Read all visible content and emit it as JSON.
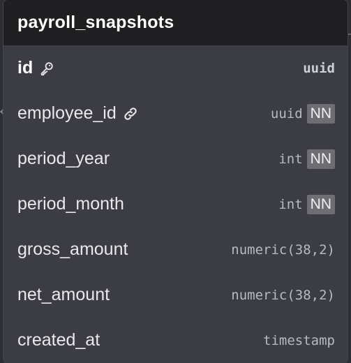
{
  "table": {
    "title": "payroll_snapshots",
    "fields": [
      {
        "name": "id",
        "type": "uuid",
        "primary_key": true,
        "icon": "key-icon",
        "nn": ""
      },
      {
        "name": "employee_id",
        "type": "uuid",
        "primary_key": false,
        "icon": "link-icon",
        "nn": "NN"
      },
      {
        "name": "period_year",
        "type": "int",
        "primary_key": false,
        "icon": "",
        "nn": "NN"
      },
      {
        "name": "period_month",
        "type": "int",
        "primary_key": false,
        "icon": "",
        "nn": "NN"
      },
      {
        "name": "gross_amount",
        "type": "numeric(38,2)",
        "primary_key": false,
        "icon": "",
        "nn": ""
      },
      {
        "name": "net_amount",
        "type": "numeric(38,2)",
        "primary_key": false,
        "icon": "",
        "nn": ""
      },
      {
        "name": "created_at",
        "type": "timestamp",
        "primary_key": false,
        "icon": "",
        "nn": ""
      }
    ]
  },
  "colors": {
    "canvas": "#2d2e33",
    "card": "#3b3c44",
    "header": "#1f1f22",
    "badge": "#6d6d72"
  }
}
